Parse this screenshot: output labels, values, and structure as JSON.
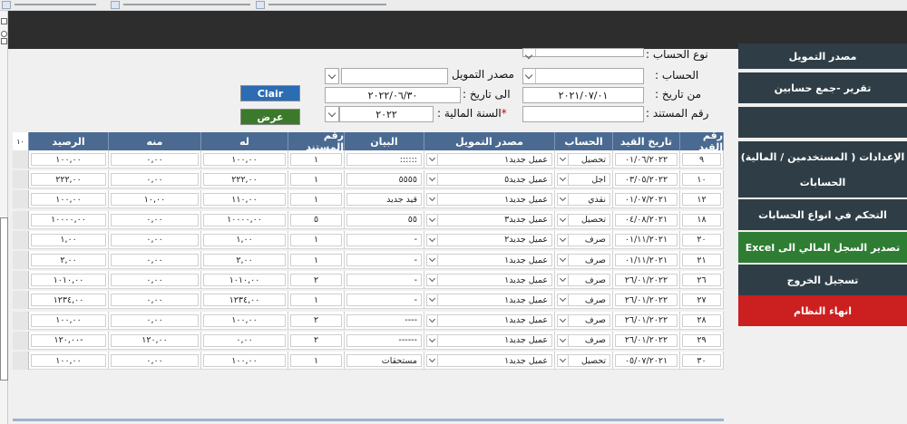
{
  "form": {
    "account_type_label": "نوع الحساب :",
    "account_label": "الحساب :",
    "funding_source_label": "مصدر التمويل",
    "from_date_label": "من تاريخ :",
    "from_date_value": "٢٠٢١/٠٧/٠١",
    "to_date_label": "الى تاريخ :",
    "to_date_value": "٢٠٢٢/٠٦/٣٠",
    "doc_number_label": "رقم المستند :",
    "fiscal_year_label": "السنة المالية :",
    "fiscal_year_value": "٢٠٢٢",
    "required_mark": "*",
    "clear_button": "Clair",
    "show_button": "عرض"
  },
  "sidebar": {
    "items": [
      {
        "label": "مصدر التمويل",
        "style": "dark"
      },
      {
        "label": "تقرير -جمع حسابين",
        "style": "dark"
      },
      {
        "label": "",
        "style": "dark"
      },
      {
        "label": "الإعدادات ( المستخدمين / المالية)",
        "style": "dark"
      },
      {
        "label": "الحسابات",
        "style": "dark"
      },
      {
        "label": "التحكم في انواع الحسابات",
        "style": "dark"
      },
      {
        "label": "تصدير السجل المالي الى Excel",
        "style": "green"
      },
      {
        "label": "تسجيل الخروج",
        "style": "dark"
      },
      {
        "label": "انهاء النظام",
        "style": "red"
      }
    ]
  },
  "grid": {
    "extra_header": "١٠",
    "columns": [
      "رقم القيد",
      "تاريخ القيد",
      "الحساب",
      "مصدر التمويل",
      "البيان",
      "رقم المستند",
      "له",
      "منه",
      "الرصيد"
    ],
    "rows": [
      [
        "٩",
        "٠١/٠٦/٢٠٢٢",
        "تحصيل",
        "عميل جديد١",
        "::::::",
        "١",
        "١٠٠,٠٠",
        "٠,٠٠",
        "١٠٠,٠٠"
      ],
      [
        "١٠",
        "٠٣/٠٥/٢٠٢٢",
        "اجل",
        "عميل جديد٥",
        "٥٥٥٥",
        "١",
        "٢٢٢,٠٠",
        "٠,٠٠",
        "٢٢٢,٠٠"
      ],
      [
        "١٢",
        "٠١/٠٧/٢٠٢١",
        "نقدي",
        "عميل جديد١",
        "قيد جديد",
        "١",
        "١١٠,٠٠",
        "١٠,٠٠",
        "١٠٠,٠٠"
      ],
      [
        "١٨",
        "٠٤/٠٨/٢٠٢١",
        "تحصيل",
        "عميل جديد٣",
        "٥٥",
        "٥",
        "١٠٠٠٠,٠٠",
        "٠,٠٠",
        "١٠٠٠٠,٠٠"
      ],
      [
        "٢٠",
        "٠١/١١/٢٠٢١",
        "صرف",
        "عميل جديد٢",
        "-",
        "١",
        "١,٠٠",
        "٠,٠٠",
        "١,٠٠"
      ],
      [
        "٢١",
        "٠١/١١/٢٠٢١",
        "صرف",
        "عميل جديد١",
        "-",
        "١",
        "٢,٠٠",
        "٠,٠٠",
        "٢,٠٠"
      ],
      [
        "٢٦",
        "٢٦/٠١/٢٠٢٢",
        "صرف",
        "عميل جديد١",
        "-",
        "٢",
        "١٠١٠,٠٠",
        "٠,٠٠",
        "١٠١٠,٠٠"
      ],
      [
        "٢٧",
        "٢٦/٠١/٢٠٢٢",
        "صرف",
        "عميل جديد١",
        "-",
        "١",
        "١٢٣٤,٠٠",
        "٠,٠٠",
        "١٢٣٤,٠٠"
      ],
      [
        "٢٨",
        "٢٦/٠١/٢٠٢٢",
        "صرف",
        "عميل جديد١",
        "----",
        "٢",
        "١٠٠,٠٠",
        "٠,٠٠",
        "١٠٠,٠٠"
      ],
      [
        "٢٩",
        "٢٦/٠١/٢٠٢٢",
        "صرف",
        "عميل جديد١",
        "------",
        "٢",
        "٠,٠٠",
        "١٢٠,٠٠",
        "-١٢٠,٠٠"
      ],
      [
        "٣٠",
        "٠٥/٠٧/٢٠٢١",
        "تحصيل",
        "عميل جديد١",
        "مستحقات",
        "١",
        "١٠٠,٠٠",
        "٠,٠٠",
        "١٠٠,٠٠"
      ]
    ]
  }
}
